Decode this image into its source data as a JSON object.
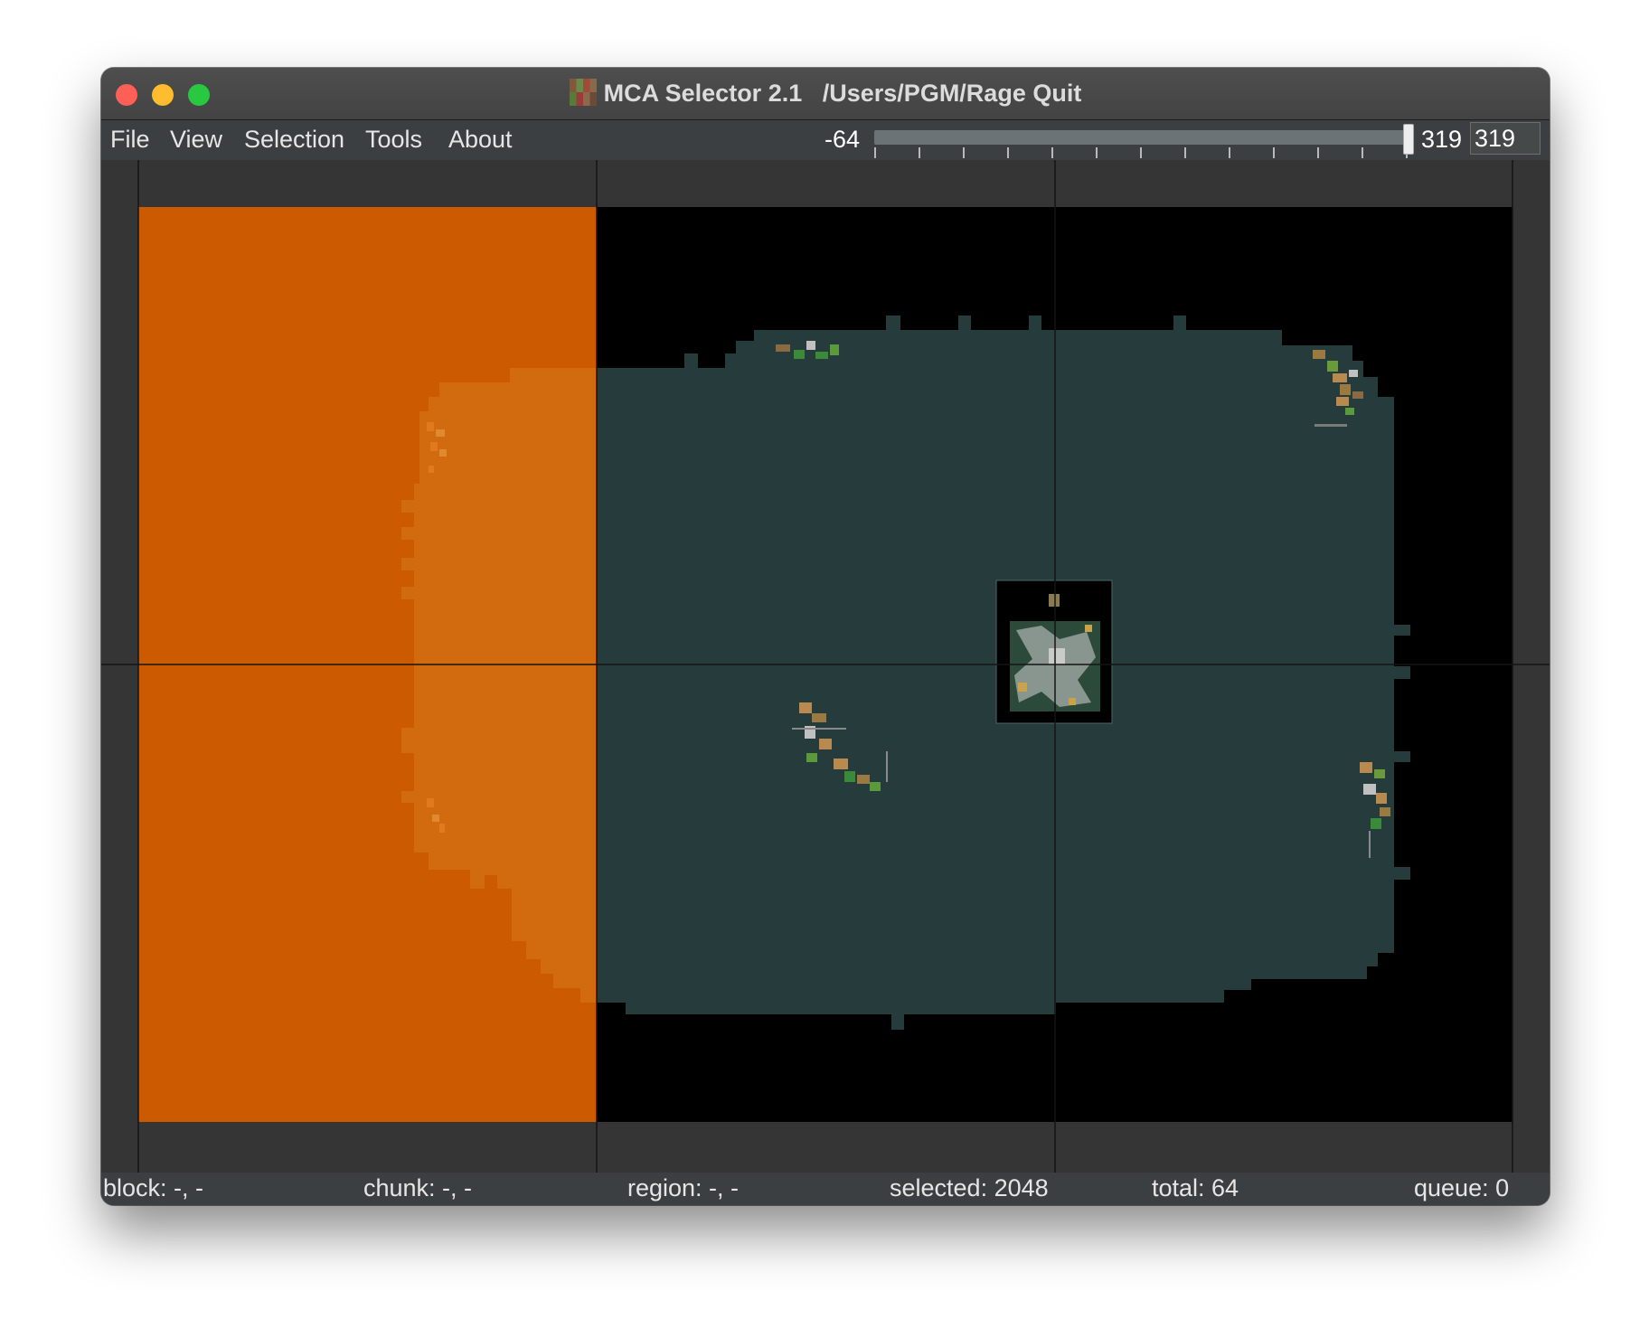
{
  "window": {
    "title": "MCA Selector 2.1",
    "path": "/Users/PGM/Rage Quit"
  },
  "menu": {
    "items": [
      "File",
      "View",
      "Selection",
      "Tools",
      "About"
    ]
  },
  "height_slider": {
    "min_label": "-64",
    "max_label": "319",
    "value": 319,
    "input_value": "319"
  },
  "status": {
    "block": "block: -, -",
    "chunk": "chunk: -, -",
    "region": "region: -, -",
    "selected": "selected: 2048",
    "total": "total: 64",
    "queue": "queue: 0"
  },
  "colors": {
    "selection_overlay": "#cc5a00",
    "explored_terrain": "#263c3c",
    "unexplored": "#000000",
    "map_border": "#353535"
  }
}
